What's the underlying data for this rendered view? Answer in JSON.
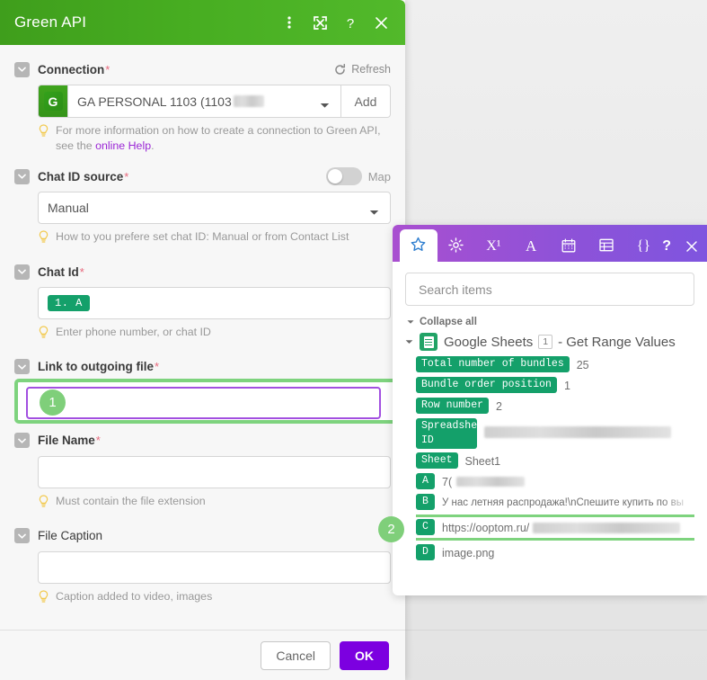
{
  "modal": {
    "title": "Green API",
    "header_icons": [
      "more-vertical-icon",
      "expand-icon",
      "help-icon",
      "close-icon"
    ],
    "fields": [
      {
        "label": "Connection",
        "required": true,
        "refresh_label": "Refresh",
        "connection_value": "GA PERSONAL 1103 (1103",
        "add_label": "Add",
        "hint_pre": "For more information on how to create a connection to Green API, see the ",
        "hint_link": "online Help",
        "hint_post": "."
      },
      {
        "label": "Chat ID source",
        "required": true,
        "map_label": "Map",
        "value": "Manual",
        "hint": "How to you prefere set chat ID: Manual or from Contact List"
      },
      {
        "label": "Chat Id",
        "required": true,
        "token": "1. A",
        "hint": "Enter phone number, or chat ID"
      },
      {
        "label": "Link to outgoing file",
        "required": true,
        "value": "",
        "hint": ""
      },
      {
        "label": "File Name",
        "required": true,
        "value": "",
        "hint": "Must contain the file extension"
      },
      {
        "label": "File Caption",
        "required": false,
        "value": "",
        "hint": "Caption added to video, images"
      }
    ],
    "footer": {
      "cancel_label": "Cancel",
      "ok_label": "OK"
    }
  },
  "panel": {
    "tabs": [
      {
        "name": "favorites-tab",
        "glyph": "star-icon",
        "active": true
      },
      {
        "name": "settings-tab",
        "glyph": "gear-icon",
        "active": false
      },
      {
        "name": "math-tab",
        "glyph": "X¹",
        "active": false
      },
      {
        "name": "text-tab",
        "glyph": "A",
        "active": false
      },
      {
        "name": "date-tab",
        "glyph": "calendar-icon",
        "active": false
      },
      {
        "name": "array-tab",
        "glyph": "table-icon",
        "active": false
      },
      {
        "name": "general-tab",
        "glyph": "{}",
        "active": false
      }
    ],
    "help_label": "?",
    "close_label": "×",
    "search_placeholder": "Search items",
    "collapse_all_label": "Collapse all",
    "tree": {
      "module_name": "Google Sheets",
      "module_number": "1",
      "module_action": "- Get Range Values",
      "items": [
        {
          "tag": "Total number of bundles",
          "value": "25",
          "type": "text",
          "highlighted": false
        },
        {
          "tag": "Bundle order position",
          "value": "1",
          "type": "text",
          "highlighted": false
        },
        {
          "tag": "Row number",
          "value": "2",
          "type": "text",
          "highlighted": false
        },
        {
          "tag": "Spreadsheet\nID",
          "value": "",
          "type": "blurred",
          "highlighted": false
        },
        {
          "tag": "Sheet",
          "value": "Sheet1",
          "type": "text",
          "highlighted": false
        },
        {
          "tag": "A",
          "value": "7(",
          "type": "partial-blurred",
          "highlighted": false
        },
        {
          "tag": "B",
          "value": "У нас летняя распродажа!\\nСпешите купить по вы",
          "type": "text",
          "highlighted": false
        },
        {
          "tag": "C",
          "value": "https://ooptom.ru/",
          "type": "partial-blurred",
          "highlighted": true
        },
        {
          "tag": "D",
          "value": "image.png",
          "type": "text",
          "highlighted": false
        }
      ]
    }
  },
  "annotations": {
    "badge_1": "1",
    "badge_2": "2"
  },
  "colors": {
    "green_header": "#47ad21",
    "purple_accent": "#7c00e0",
    "tag_green": "#14a06a",
    "highlight_green": "#7ed37e",
    "panel_purple": "#8e52d8"
  }
}
